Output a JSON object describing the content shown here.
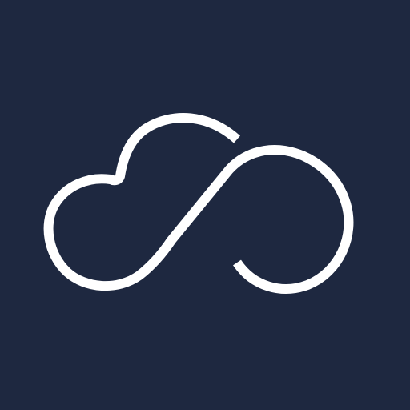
{
  "app_icon": {
    "background_color": "#1e2840",
    "logo": {
      "icon_name": "cloud-infinity-logo-icon",
      "stroke_color": "#ffffff"
    }
  }
}
